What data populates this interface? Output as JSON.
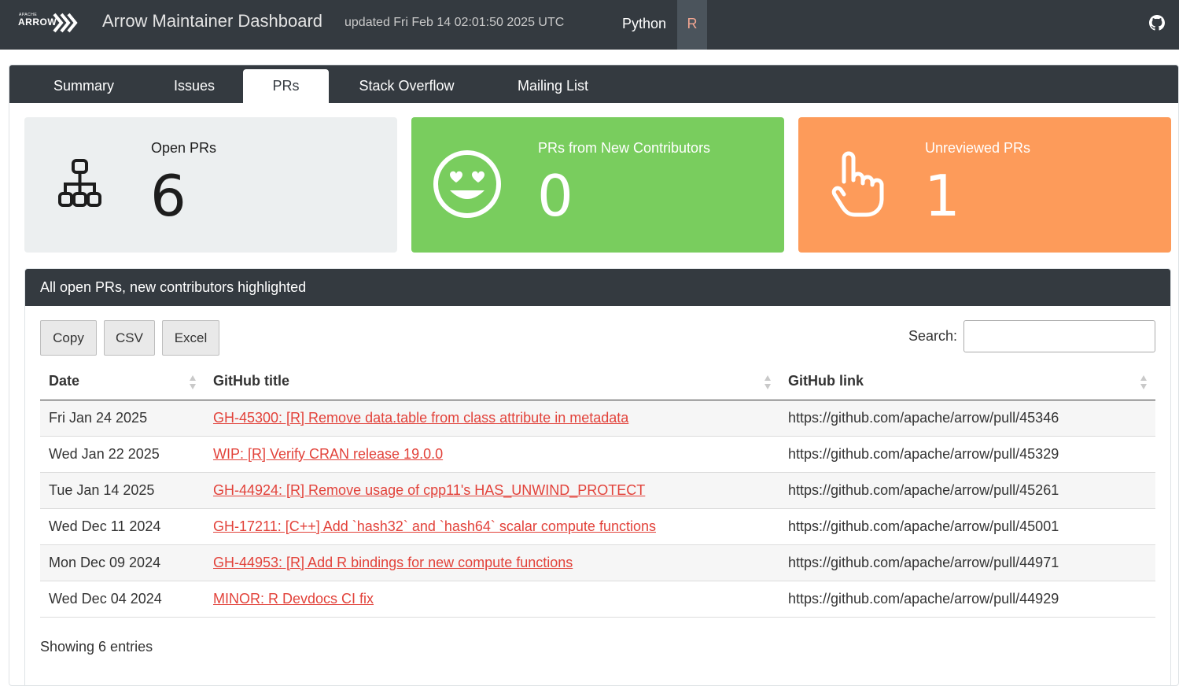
{
  "header": {
    "logo_small": "APACHE",
    "logo_word": "ARROW",
    "title": "Arrow Maintainer Dashboard",
    "updated": "updated Fri Feb 14 02:01:50 2025 UTC",
    "nav": [
      "Python",
      "R"
    ],
    "active_nav": "R",
    "github_icon": "github-icon"
  },
  "tabs": [
    {
      "label": "Summary",
      "active": false
    },
    {
      "label": "Issues",
      "active": false
    },
    {
      "label": "PRs",
      "active": true
    },
    {
      "label": "Stack Overflow",
      "active": false
    },
    {
      "label": "Mailing List",
      "active": false
    }
  ],
  "value_boxes": [
    {
      "label": "Open PRs",
      "value": "6",
      "icon": "sitemap-icon",
      "color": "#eceff0"
    },
    {
      "label": "PRs from New Contributors",
      "value": "0",
      "icon": "grin-hearts-icon",
      "color": "#79cd5e"
    },
    {
      "label": "Unreviewed PRs",
      "value": "1",
      "icon": "hand-pointer-icon",
      "color": "#fd9b5a"
    }
  ],
  "panel": {
    "title": "All open PRs, new contributors highlighted",
    "buttons": [
      "Copy",
      "CSV",
      "Excel"
    ],
    "search_label": "Search:",
    "search_value": "",
    "columns": [
      "Date",
      "GitHub title",
      "GitHub link"
    ],
    "rows": [
      {
        "date": "Fri Jan 24 2025",
        "title": "GH-45300: [R] Remove data.table from class attribute in metadata",
        "link": "https://github.com/apache/arrow/pull/45346"
      },
      {
        "date": "Wed Jan 22 2025",
        "title": "WIP: [R] Verify CRAN release 19.0.0",
        "link": "https://github.com/apache/arrow/pull/45329"
      },
      {
        "date": "Tue Jan 14 2025",
        "title": "GH-44924: [R] Remove usage of cpp11's HAS_UNWIND_PROTECT",
        "link": "https://github.com/apache/arrow/pull/45261"
      },
      {
        "date": "Wed Dec 11 2024",
        "title": "GH-17211: [C++] Add `hash32` and `hash64` scalar compute functions",
        "link": "https://github.com/apache/arrow/pull/45001"
      },
      {
        "date": "Mon Dec 09 2024",
        "title": "GH-44953: [R] Add R bindings for new compute functions",
        "link": "https://github.com/apache/arrow/pull/44971"
      },
      {
        "date": "Wed Dec 04 2024",
        "title": "MINOR: R Devdocs CI fix",
        "link": "https://github.com/apache/arrow/pull/44929"
      }
    ],
    "info": "Showing 6 entries"
  },
  "colors": {
    "navbar": "#343a40",
    "link": "#e2423a",
    "success": "#79cd5e",
    "warning": "#fd9b5a"
  }
}
